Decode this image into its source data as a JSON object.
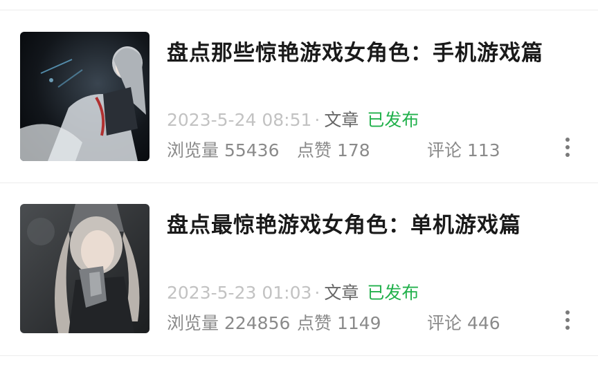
{
  "articles": [
    {
      "title": "盘点那些惊艳游戏女角色：手机游戏篇",
      "date": "2023-5-24 08:51",
      "separator": "·",
      "type": "文章",
      "status": "已发布",
      "views_label": "浏览量",
      "views": "55436",
      "likes_label": "点赞",
      "likes": "178",
      "comments_label": "评论",
      "comments": "113",
      "thumbnail_icon": "game-character-thumbnail"
    },
    {
      "title": "盘点最惊艳游戏女角色：单机游戏篇",
      "date": "2023-5-23 01:03",
      "separator": "·",
      "type": "文章",
      "status": "已发布",
      "views_label": "浏览量",
      "views": "224856",
      "likes_label": "点赞",
      "likes": "1149",
      "comments_label": "评论",
      "comments": "446",
      "thumbnail_icon": "game-character-thumbnail"
    }
  ],
  "colors": {
    "title": "#1a1a1a",
    "date": "#c2c2c2",
    "status_published": "#22b14c",
    "stats": "#8a8a8a"
  }
}
